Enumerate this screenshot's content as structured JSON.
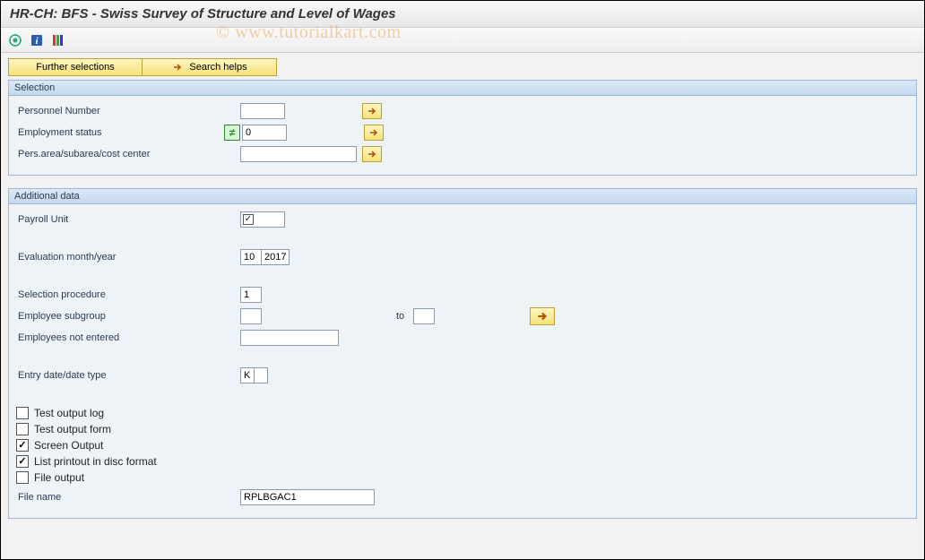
{
  "title": "HR-CH: BFS - Swiss Survey of Structure and Level of Wages",
  "watermark": "© www.tutorialkart.com",
  "toolbar": {
    "execute_icon": "execute",
    "info_icon": "info",
    "color_icon": "colors"
  },
  "buttons": {
    "further_selections": "Further selections",
    "search_helps": "Search helps"
  },
  "selection": {
    "header": "Selection",
    "personnel_number_label": "Personnel Number",
    "personnel_number_value": "",
    "employment_status_label": "Employment status",
    "employment_status_value": "0",
    "pers_area_label": "Pers.area/subarea/cost center",
    "pers_area_value": ""
  },
  "additional": {
    "header": "Additional data",
    "payroll_unit_label": "Payroll Unit",
    "payroll_unit_value": "",
    "eval_month_year_label": "Evaluation month/year",
    "eval_month": "10",
    "eval_year": "2017",
    "selection_procedure_label": "Selection procedure",
    "selection_procedure_value": "1",
    "employee_subgroup_label": "Employee subgroup",
    "employee_subgroup_from": "",
    "employee_subgroup_to_label": "to",
    "employee_subgroup_to": "",
    "employees_not_entered_label": "Employees not entered",
    "employees_not_entered_value": "",
    "entry_date_label": "Entry date/date type",
    "entry_date_v1": "K",
    "entry_date_v2": "",
    "cb_test_output_log": "Test output log",
    "cb_test_output_form": "Test output form",
    "cb_screen_output": "Screen Output",
    "cb_list_printout": "List printout in disc format",
    "cb_file_output": "File output",
    "file_name_label": "File name",
    "file_name_value": "RPLBGAC1"
  }
}
